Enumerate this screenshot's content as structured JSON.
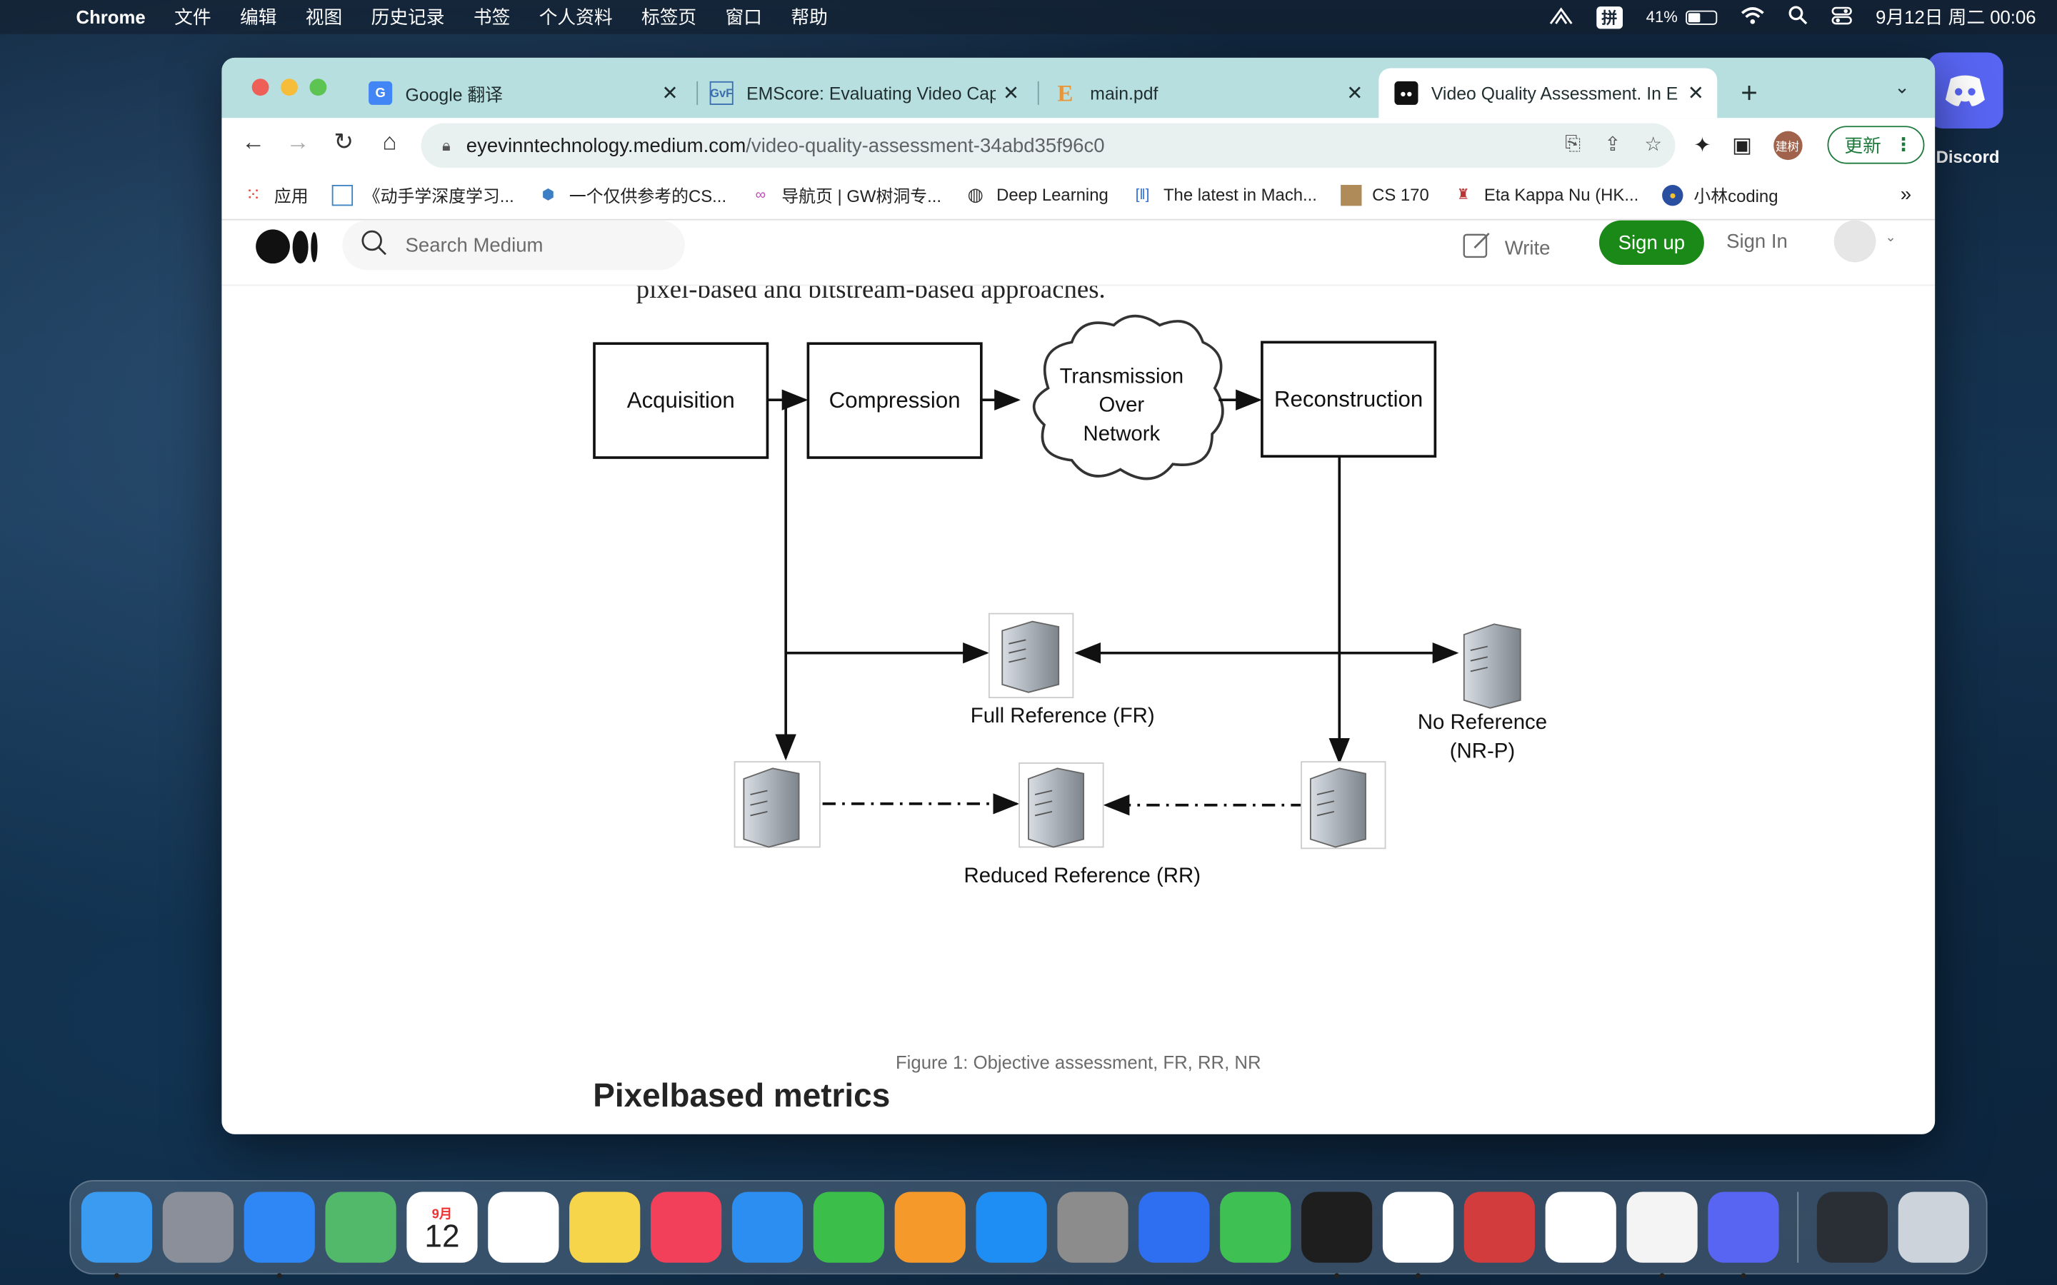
{
  "menubar": {
    "app_name": "Chrome",
    "items": [
      "文件",
      "编辑",
      "视图",
      "历史记录",
      "书签",
      "个人资料",
      "标签页",
      "窗口",
      "帮助"
    ],
    "ime_label": "拼",
    "battery_percent": "41%",
    "datetime": "9月12日 周二 00:06"
  },
  "tabs": [
    {
      "title": "Google 翻译",
      "favicon": "google-translate-icon",
      "active": false
    },
    {
      "title": "EMScore: Evaluating Video Cap",
      "favicon": "gvf-icon",
      "active": false
    },
    {
      "title": "main.pdf",
      "favicon": "overleaf-icon",
      "active": false
    },
    {
      "title": "Video Quality Assessment. In E",
      "favicon": "medium-icon",
      "active": true
    }
  ],
  "toolbar": {
    "url_domain": "eyevinntechnology.medium.com",
    "url_path": "/video-quality-assessment-34abd35f96c0",
    "profile_initials": "建树",
    "update_label": "更新"
  },
  "bookmarks": [
    {
      "label": "应用",
      "icon": "apps-grid-icon"
    },
    {
      "label": "《动手学深度学习...",
      "icon": "book-icon"
    },
    {
      "label": "一个仅供参考的CS...",
      "icon": "cube-icon"
    },
    {
      "label": "导航页 | GW树洞专...",
      "icon": "link-icon"
    },
    {
      "label": "Deep Learning",
      "icon": "globe-icon"
    },
    {
      "label": "The latest in Mach...",
      "icon": "paperswithcode-icon"
    },
    {
      "label": "CS 170",
      "icon": "image-icon"
    },
    {
      "label": "Eta Kappa Nu (HK...",
      "icon": "hkn-icon"
    },
    {
      "label": "小林coding",
      "icon": "avatar-icon"
    }
  ],
  "medium": {
    "search_placeholder": "Search Medium",
    "write_label": "Write",
    "signup_label": "Sign up",
    "signin_label": "Sign In"
  },
  "article": {
    "body_line": "pixel-based and bitstream-based approaches.",
    "figure_caption": "Figure 1: Objective assessment, FR, RR, NR",
    "section_heading": "Pixelbased metrics"
  },
  "diagram": {
    "box_acquisition": "Acquisition",
    "box_compression": "Compression",
    "cloud_line1": "Transmission",
    "cloud_line2": "Over",
    "cloud_line3": "Network",
    "box_reconstruction": "Reconstruction",
    "label_fr": "Full Reference (FR)",
    "label_nr1": "No Reference",
    "label_nr2": "(NR-P)",
    "label_rr": "Reduced Reference (RR)"
  },
  "desktop": {
    "discord_label": "Discord"
  },
  "dock": [
    {
      "name": "finder",
      "color": "#3a9bf0"
    },
    {
      "name": "launchpad",
      "color": "#8a8f99"
    },
    {
      "name": "safari",
      "color": "#2f86f5"
    },
    {
      "name": "maps",
      "color": "#52b86a"
    },
    {
      "name": "calendar",
      "color": "#ffffff"
    },
    {
      "name": "reminders",
      "color": "#ffffff"
    },
    {
      "name": "notes",
      "color": "#f7d54a"
    },
    {
      "name": "music",
      "color": "#f2405a"
    },
    {
      "name": "keynote",
      "color": "#2c8ef0"
    },
    {
      "name": "numbers",
      "color": "#3bbf4a"
    },
    {
      "name": "pages",
      "color": "#f59a2a"
    },
    {
      "name": "app-store",
      "color": "#1e8ef5"
    },
    {
      "name": "system-settings",
      "color": "#8c8c8c"
    },
    {
      "name": "lark",
      "color": "#2e6ef0"
    },
    {
      "name": "wechat",
      "color": "#3fc052"
    },
    {
      "name": "terminal",
      "color": "#1e1e1e"
    },
    {
      "name": "chrome",
      "color": "#ffffff"
    },
    {
      "name": "zotero",
      "color": "#d33c3c"
    },
    {
      "name": "vscode",
      "color": "#ffffff"
    },
    {
      "name": "typora",
      "color": "#f4f4f4"
    },
    {
      "name": "discord",
      "color": "#5865f2"
    }
  ],
  "dock_calendar": {
    "month": "9月",
    "day": "12"
  }
}
